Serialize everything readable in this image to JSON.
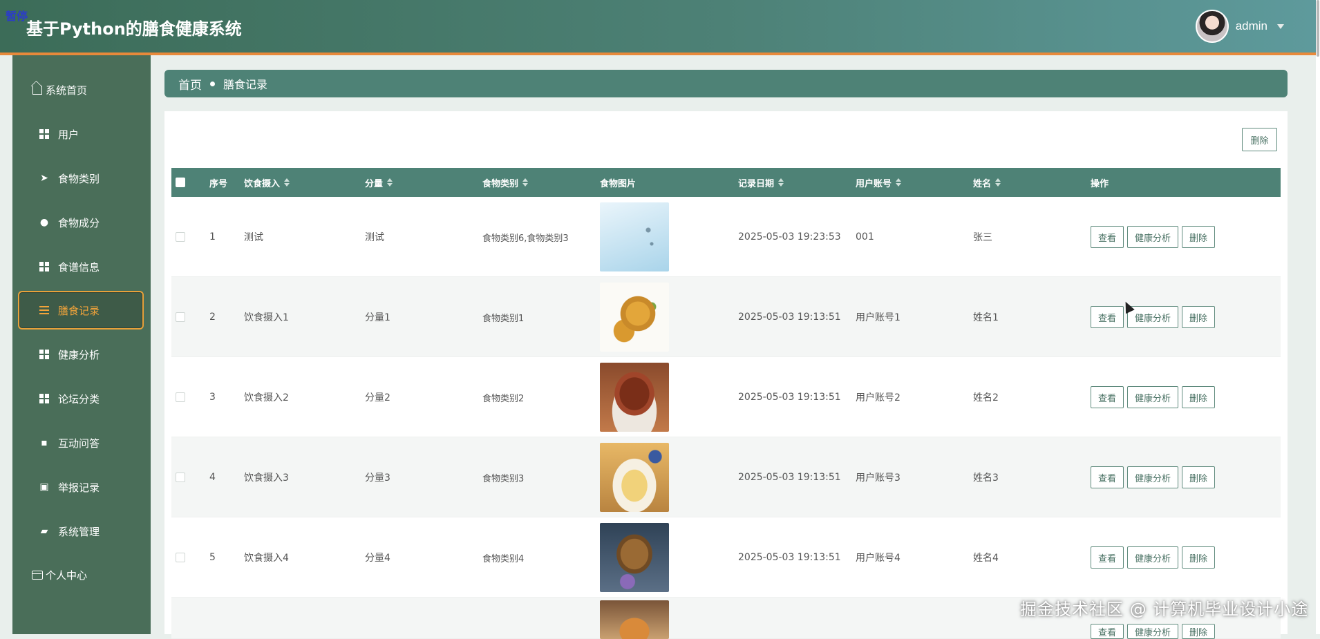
{
  "header": {
    "pause_badge": "暂停",
    "title": "基于Python的膳食健康系统",
    "user_name": "admin"
  },
  "sidebar": {
    "items": [
      {
        "label": "系统首页",
        "icon": "home-icon"
      },
      {
        "label": "用户",
        "icon": "grid-icon"
      },
      {
        "label": "食物类别",
        "icon": "paper-plane-icon"
      },
      {
        "label": "食物成分",
        "icon": "bulb-icon"
      },
      {
        "label": "食谱信息",
        "icon": "grid-icon"
      },
      {
        "label": "膳食记录",
        "icon": "list-icon",
        "active": true
      },
      {
        "label": "健康分析",
        "icon": "grid-icon"
      },
      {
        "label": "论坛分类",
        "icon": "grid-icon"
      },
      {
        "label": "互动问答",
        "icon": "chat-icon"
      },
      {
        "label": "举报记录",
        "icon": "clipboard-icon"
      },
      {
        "label": "系统管理",
        "icon": "settings-icon"
      },
      {
        "label": "个人中心",
        "icon": "card-icon"
      }
    ]
  },
  "breadcrumb": {
    "home": "首页",
    "current": "膳食记录"
  },
  "toolbar": {
    "delete_label": "删除"
  },
  "table": {
    "columns": [
      "序号",
      "饮食摄入",
      "分量",
      "食物类别",
      "食物图片",
      "记录日期",
      "用户账号",
      "姓名",
      "操作"
    ],
    "rows": [
      {
        "index": "1",
        "intake": "测试",
        "portion": "测试",
        "category": "食物类别6,食物类别3",
        "image": "sky-splash",
        "date": "2025-05-03 19:23:53",
        "account": "001",
        "name": "张三"
      },
      {
        "index": "2",
        "intake": "饮食摄入1",
        "portion": "分量1",
        "category": "食物类别1",
        "image": "fried-snack",
        "date": "2025-05-03 19:13:51",
        "account": "用户账号1",
        "name": "姓名1"
      },
      {
        "index": "3",
        "intake": "饮食摄入2",
        "portion": "分量2",
        "category": "食物类别2",
        "image": "braised-meat",
        "date": "2025-05-03 19:13:51",
        "account": "用户账号2",
        "name": "姓名2"
      },
      {
        "index": "4",
        "intake": "饮食摄入3",
        "portion": "分量3",
        "category": "食物类别3",
        "image": "potato-dish",
        "date": "2025-05-03 19:13:51",
        "account": "用户账号3",
        "name": "姓名3"
      },
      {
        "index": "5",
        "intake": "饮食摄入4",
        "portion": "分量4",
        "category": "食物类别4",
        "image": "roast-chicken",
        "date": "2025-05-03 19:13:51",
        "account": "用户账号4",
        "name": "姓名4"
      }
    ],
    "actions": {
      "view": "查看",
      "analyze": "健康分析",
      "delete": "删除"
    }
  },
  "watermark": "掘金技术社区 @ 计算机毕业设计小途",
  "colors": {
    "header": "#4d8176",
    "sidebar": "#4a6e59",
    "accent": "#e8893a",
    "table_header": "#4e8276"
  }
}
